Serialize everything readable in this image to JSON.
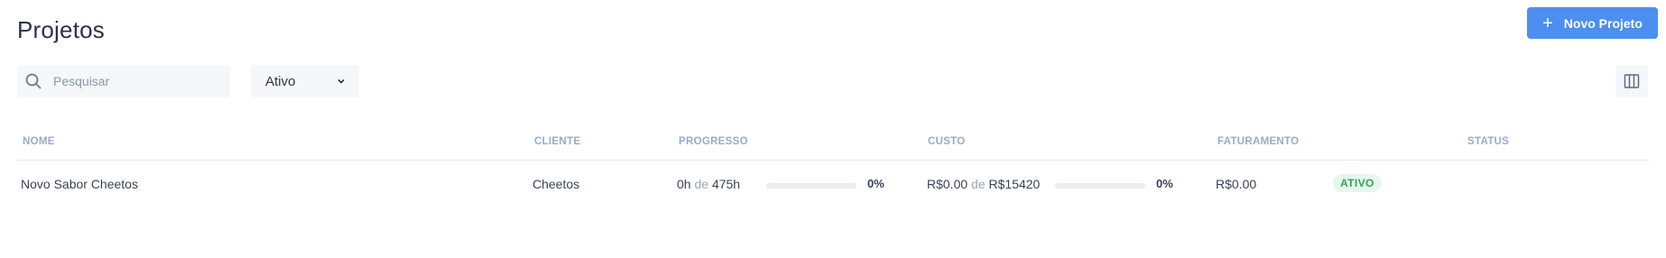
{
  "page": {
    "title": "Projetos"
  },
  "toolbar": {
    "new_project_label": "Novo Projeto",
    "search_placeholder": "Pesquisar",
    "status_filter_value": "Ativo"
  },
  "table": {
    "columns": [
      "NOME",
      "CLIENTE",
      "PROGRESSO",
      "CUSTO",
      "FATURAMENTO",
      "STATUS"
    ],
    "rows": [
      {
        "name": "Novo Sabor Cheetos",
        "client": "Cheetos",
        "progress_done": "0h",
        "progress_joiner": "de",
        "progress_total": "475h",
        "progress_pct": "0%",
        "progress_fraction": 0,
        "cost_done": "R$0.00",
        "cost_joiner": "de",
        "cost_total": "R$15420",
        "cost_pct": "0%",
        "cost_fraction": 0,
        "billing": "R$0.00",
        "status": "ATIVO"
      }
    ]
  },
  "colors": {
    "accent": "#4c8ff0",
    "status_active_bg": "#e7f6ec",
    "status_active_text": "#2fa55a"
  },
  "icons": [
    "plus-icon",
    "search-icon",
    "chevron-down-icon",
    "columns-icon"
  ]
}
